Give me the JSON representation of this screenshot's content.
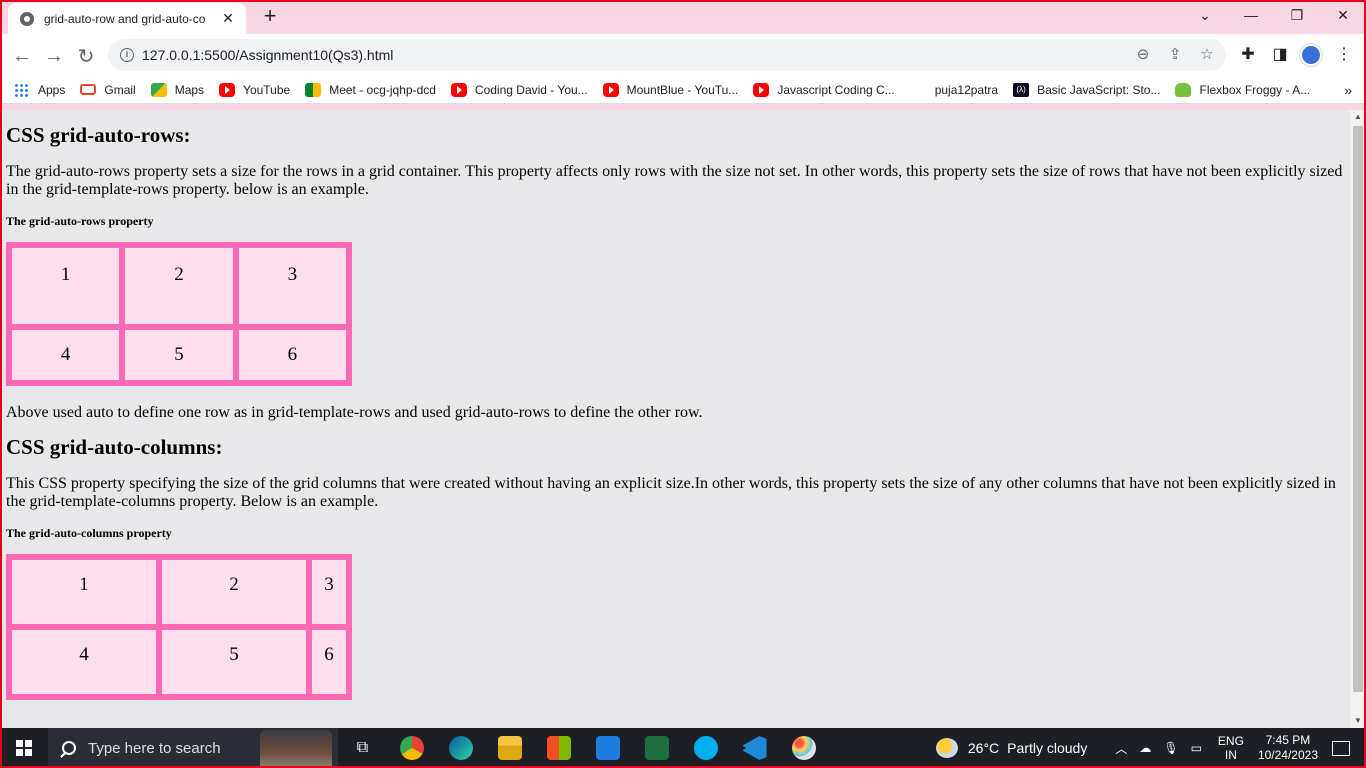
{
  "browser": {
    "tab_title": "grid-auto-row and grid-auto-co",
    "url": "127.0.0.1:5500/Assignment10(Qs3).html",
    "bookmarks": [
      {
        "label": "Apps",
        "icon": "apps-icon"
      },
      {
        "label": "Gmail",
        "icon": "gmail-icon"
      },
      {
        "label": "Maps",
        "icon": "maps-icon"
      },
      {
        "label": "YouTube",
        "icon": "youtube-icon"
      },
      {
        "label": "Meet - ocg-jqhp-dcd",
        "icon": "meet-icon"
      },
      {
        "label": "Coding David - You...",
        "icon": "youtube-icon"
      },
      {
        "label": "MountBlue - YouTu...",
        "icon": "youtube-icon"
      },
      {
        "label": "Javascript Coding C...",
        "icon": "youtube-icon"
      },
      {
        "label": "puja12patra",
        "icon": ""
      },
      {
        "label": "Basic JavaScript: Sto...",
        "icon": "freecodecamp-icon"
      },
      {
        "label": "Flexbox Froggy - A...",
        "icon": "froggy-icon"
      }
    ]
  },
  "page": {
    "section1": {
      "heading": "CSS grid-auto-rows:",
      "description": "The grid-auto-rows property sets a size for the rows in a grid container. This property affects only rows with the size not set. In other words, this property sets the size of rows that have not been explicitly sized in the grid-template-rows property. below is an example.",
      "caption": "The grid-auto-rows property",
      "cells": [
        "1",
        "2",
        "3",
        "4",
        "5",
        "6"
      ],
      "note": "Above used auto to define one row as in grid-template-rows and used grid-auto-rows to define the other row."
    },
    "section2": {
      "heading": "CSS grid-auto-columns:",
      "description": "This CSS property specifying the size of the grid columns that were created without having an explicit size.In other words, this property sets the size of any other columns that have not been explicitly sized in the grid-template-columns property. Below is an example.",
      "caption": "The grid-auto-columns property",
      "cells": [
        "1",
        "2",
        "3",
        "4",
        "5",
        "6"
      ]
    }
  },
  "taskbar": {
    "search_placeholder": "Type here to search",
    "weather_temp": "26°C",
    "weather_text": "Partly cloudy",
    "lang_top": "ENG",
    "lang_bottom": "IN",
    "time": "7:45 PM",
    "date": "10/24/2023"
  },
  "colors": {
    "grid_border": "#ff69b4",
    "grid_cell": "#ffdfee",
    "tab_strip": "#f9d6e4",
    "page_bg": "#e8e8ea"
  }
}
